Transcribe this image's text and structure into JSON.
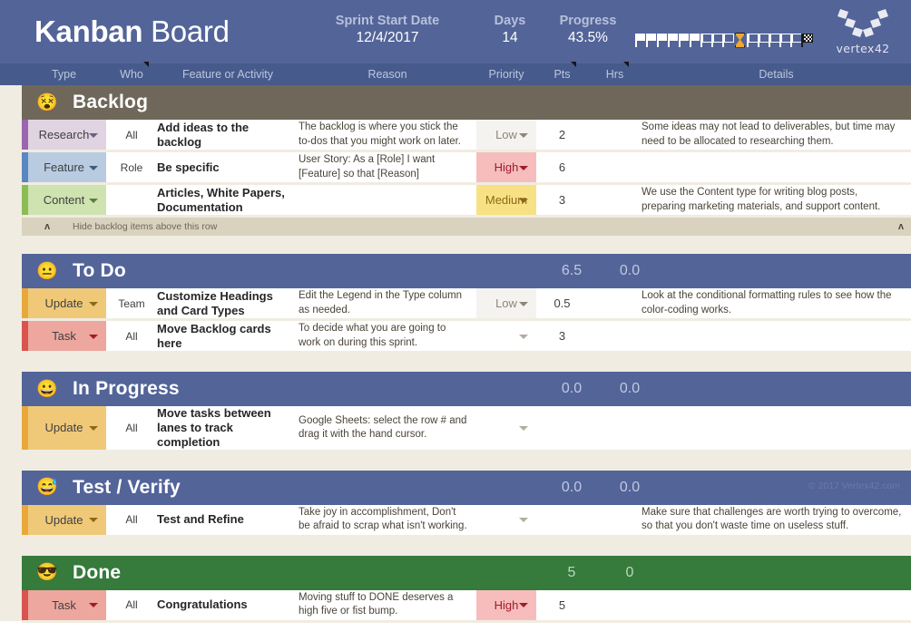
{
  "header": {
    "title_bold": "Kanban",
    "title_light": " Board",
    "sprint_label": "Sprint Start Date",
    "sprint_value": "12/4/2017",
    "days_label": "Days",
    "days_value": "14",
    "progress_label": "Progress",
    "progress_value": "43.5%",
    "progress_filled_flags": 6,
    "progress_empty_flags_before": 3,
    "progress_empty_flags_after": 5,
    "progress_marker_icon": "hourglass-icon",
    "progress_end_icon": "checkered-flag-icon",
    "logo_word": "vertex42",
    "accent_header": "#536499",
    "accent_colhead": "#475a8c"
  },
  "columns": [
    {
      "label": "Type",
      "note": false
    },
    {
      "label": "Who",
      "note": true
    },
    {
      "label": "Feature or Activity",
      "note": false
    },
    {
      "label": "Reason",
      "note": false
    },
    {
      "label": "Priority",
      "note": false
    },
    {
      "label": "Pts",
      "note": true
    },
    {
      "label": "Hrs",
      "note": true
    },
    {
      "label": "Details",
      "note": false
    }
  ],
  "watermark": "© 2017 Vertex42.com",
  "hide_row": {
    "label": "Hide backlog items above this row",
    "chevron_left": "ʌ",
    "chevron_right": "ʌ"
  },
  "lanes": [
    {
      "id": "backlog",
      "title": "Backlog",
      "emoji": "😵",
      "emoji_name": "exploding-head-emoji",
      "bg": "#6f685a",
      "pts_total": "",
      "hrs_total": "",
      "watermark": false,
      "has_hide_row": true,
      "rows": [
        {
          "type": "Research",
          "type_bg": "#e0d4e3",
          "type_accent": "#9b65b0",
          "caret": "#6f5f7c",
          "who": "All",
          "feature": "Add ideas to the backlog",
          "reason": "The backlog is where you stick the to-dos that you might work on later.",
          "priority": "Low",
          "pri_bg": "#f5f3ef",
          "pri_color": "#8c867a",
          "pri_caret": "#8c867a",
          "pts": "2",
          "hrs": "",
          "details": "Some ideas may not lead to deliverables, but time may need to be allocated to researching them."
        },
        {
          "type": "Feature",
          "type_bg": "#b9cbe1",
          "type_accent": "#5b87c0",
          "caret": "#3e5c80",
          "who": "Role",
          "feature": "Be specific",
          "reason": "User Story: As a [Role] I want [Feature] so that [Reason]",
          "priority": "High",
          "pri_bg": "#f7bdbd",
          "pri_color": "#a01b2a",
          "pri_caret": "#a01b2a",
          "pts": "6",
          "hrs": "",
          "details": ""
        },
        {
          "type": "Content",
          "type_bg": "#cfe3b0",
          "type_accent": "#8cbd54",
          "caret": "#5f7a43",
          "who": "",
          "feature": "Articles, White Papers, Documentation",
          "reason": "",
          "priority": "Medium",
          "pri_bg": "#f8e185",
          "pri_color": "#8a6a17",
          "pri_caret": "#8a6a17",
          "pts": "3",
          "hrs": "",
          "details": "We use the Content type for writing blog posts, preparing marketing materials, and support content."
        }
      ]
    },
    {
      "id": "todo",
      "title": "To Do",
      "emoji": "😐",
      "emoji_name": "neutral-face-emoji",
      "bg": "#536499",
      "pts_total": "6.5",
      "hrs_total": "0.0",
      "watermark": false,
      "has_hide_row": false,
      "rows": [
        {
          "type": "Update",
          "type_bg": "#f0c978",
          "type_accent": "#e8a93a",
          "caret": "#8a6a17",
          "who": "Team",
          "feature": "Customize Headings and Card Types",
          "reason": "Edit the Legend in the Type column as needed.",
          "priority": "Low",
          "pri_bg": "#f5f3ef",
          "pri_color": "#8c867a",
          "pri_caret": "#8c867a",
          "pts": "0.5",
          "hrs": "",
          "details": "Look at the conditional formatting rules to see how the color-coding works."
        },
        {
          "type": "Task",
          "type_bg": "#eda79e",
          "type_accent": "#d9534f",
          "caret": "#a01b2a",
          "who": "All",
          "feature": "Move Backlog cards here",
          "reason": "To decide what you are going to work on during this sprint.",
          "priority": "",
          "pri_bg": "#ffffff",
          "pri_color": "#8c867a",
          "pri_caret": "#b3ada0",
          "pts": "3",
          "hrs": "",
          "details": ""
        }
      ]
    },
    {
      "id": "inprogress",
      "title": "In Progress",
      "emoji": "😀",
      "emoji_name": "grinning-face-emoji",
      "bg": "#536499",
      "pts_total": "0.0",
      "hrs_total": "0.0",
      "watermark": false,
      "has_hide_row": false,
      "rows": [
        {
          "type": "Update",
          "type_bg": "#f0c978",
          "type_accent": "#e8a93a",
          "caret": "#8a6a17",
          "who": "All",
          "feature": "Move tasks between lanes to track completion",
          "reason": "Google Sheets: select the row # and drag it with the hand cursor.",
          "priority": "",
          "pri_bg": "#ffffff",
          "pri_color": "#8c867a",
          "pri_caret": "#b3ada0",
          "pts": "",
          "hrs": "",
          "details": ""
        }
      ]
    },
    {
      "id": "testverify",
      "title": "Test / Verify",
      "emoji": "😅",
      "emoji_name": "grinning-face-with-sweat-emoji",
      "bg": "#536499",
      "pts_total": "0.0",
      "hrs_total": "0.0",
      "watermark": true,
      "has_hide_row": false,
      "rows": [
        {
          "type": "Update",
          "type_bg": "#f0c978",
          "type_accent": "#e8a93a",
          "caret": "#8a6a17",
          "who": "All",
          "feature": "Test and Refine",
          "reason": "Take joy in accomplishment, Don't be afraid to scrap what isn't working.",
          "priority": "",
          "pri_bg": "#ffffff",
          "pri_color": "#8c867a",
          "pri_caret": "#b3ada0",
          "pts": "",
          "hrs": "",
          "details": "Make sure that challenges are worth trying to overcome, so that you don't waste time on useless stuff."
        }
      ]
    },
    {
      "id": "done",
      "title": "Done",
      "emoji": "😎",
      "emoji_name": "smiling-face-with-sunglasses-emoji",
      "bg": "#367a3c",
      "pts_total": "5",
      "hrs_total": "0",
      "watermark": false,
      "has_hide_row": false,
      "rows": [
        {
          "type": "Task",
          "type_bg": "#eda79e",
          "type_accent": "#d9534f",
          "caret": "#a01b2a",
          "who": "All",
          "feature": "Congratulations",
          "reason": "Moving stuff to DONE deserves a high five or fist bump.",
          "priority": "High",
          "pri_bg": "#f7bdbd",
          "pri_color": "#a01b2a",
          "pri_caret": "#a01b2a",
          "pts": "5",
          "hrs": "",
          "details": ""
        }
      ]
    }
  ]
}
